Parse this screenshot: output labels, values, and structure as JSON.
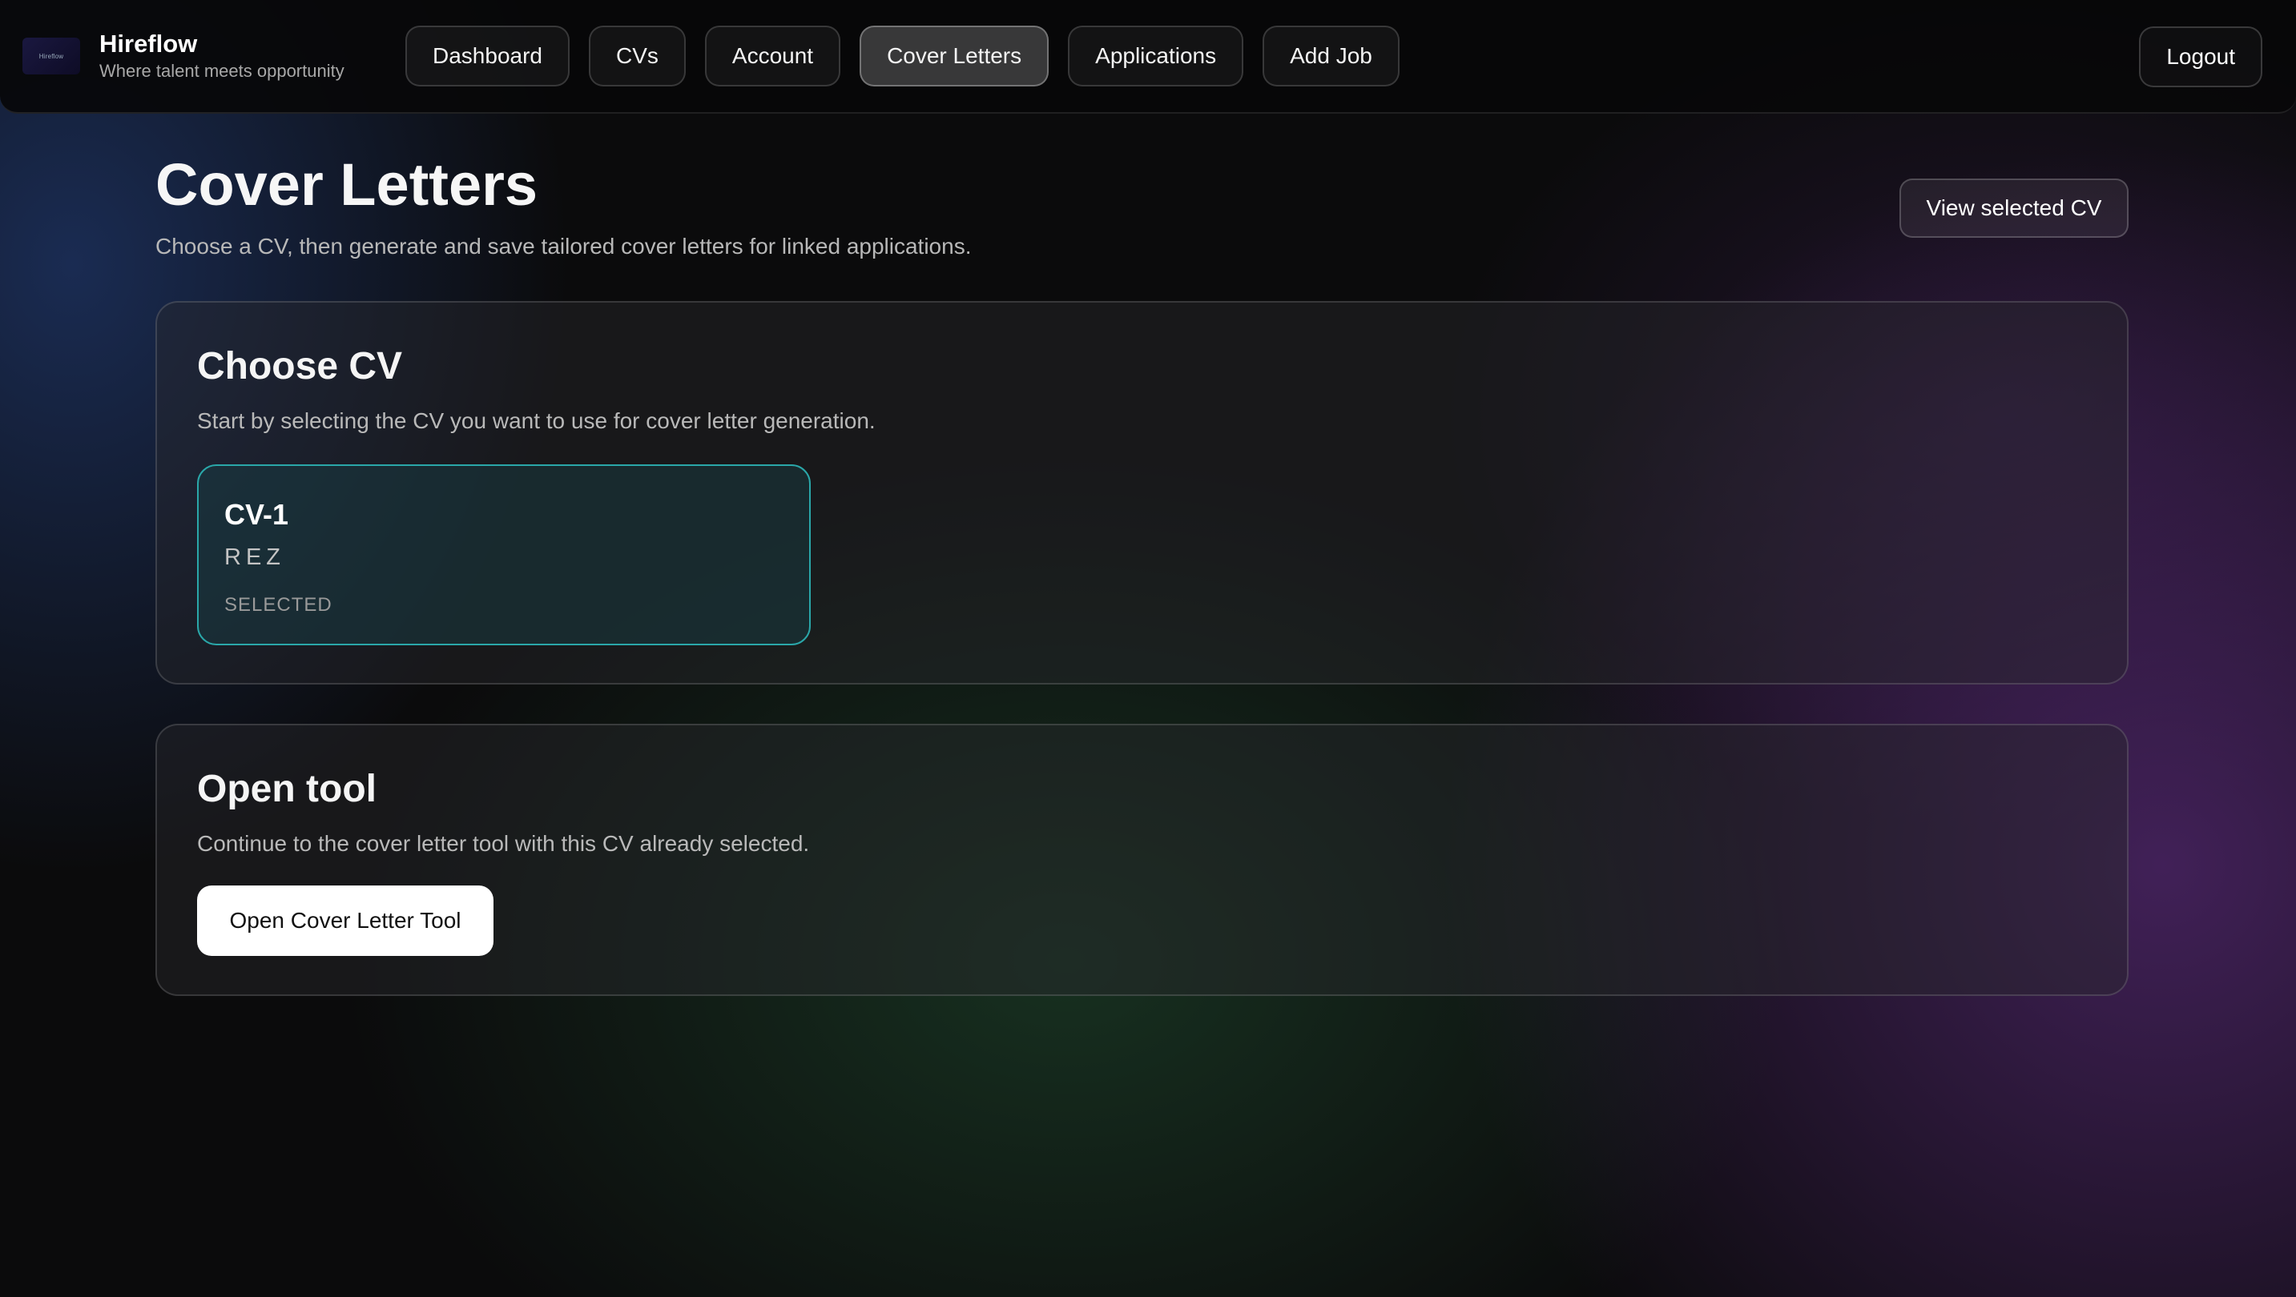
{
  "app": {
    "name": "Hireflow",
    "tagline": "Where talent meets opportunity",
    "logo_text": "Hireflow"
  },
  "nav": {
    "items": [
      {
        "label": "Dashboard",
        "active": false
      },
      {
        "label": "CVs",
        "active": false
      },
      {
        "label": "Account",
        "active": false
      },
      {
        "label": "Cover Letters",
        "active": true
      },
      {
        "label": "Applications",
        "active": false
      },
      {
        "label": "Add Job",
        "active": false
      }
    ],
    "logout_label": "Logout"
  },
  "header": {
    "title": "Cover Letters",
    "subtitle": "Choose a CV, then generate and save tailored cover letters for linked applications.",
    "view_cv_label": "View selected CV"
  },
  "choose_cv": {
    "title": "Choose CV",
    "description": "Start by selecting the CV you want to use for cover letter generation.",
    "cv": {
      "name": "CV-1",
      "subtitle": "REZ",
      "status": "SELECTED"
    }
  },
  "open_tool": {
    "title": "Open tool",
    "description": "Continue to the cover letter tool with this CV already selected.",
    "button_label": "Open Cover Letter Tool"
  },
  "colors": {
    "accent_teal": "#2aa7a9",
    "background": "#0b0b0c",
    "primary_button": "#ffffff"
  }
}
